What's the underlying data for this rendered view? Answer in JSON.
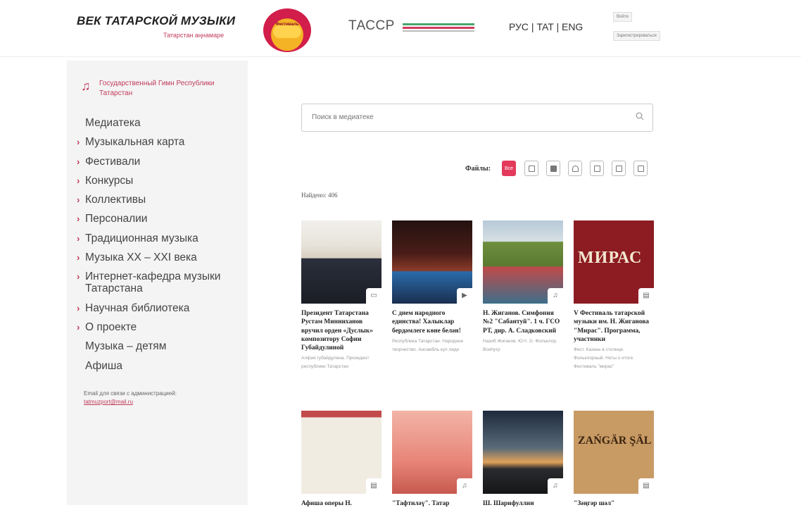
{
  "header": {
    "title": "ВЕК ТАТАРСКОЙ МУЗЫКИ",
    "subtitle": "Татарстан аңнамаре",
    "logo_text": "Фестиваль",
    "tassr": "ТАССР",
    "lang": "РУС | TAT | ENG",
    "login": "Войти",
    "register": "Зарегистрироваться"
  },
  "sidebar": {
    "anthem": "Государственный Гимн Республики Татарстан",
    "items": [
      {
        "label": "Медиатека",
        "arrow": false
      },
      {
        "label": "Музыкальная карта",
        "arrow": true
      },
      {
        "label": "Фестивали",
        "arrow": true
      },
      {
        "label": "Конкурсы",
        "arrow": true
      },
      {
        "label": "Коллективы",
        "arrow": true
      },
      {
        "label": "Персоналии",
        "arrow": true
      },
      {
        "label": "Традиционная музыка",
        "arrow": true
      },
      {
        "label": "Музыка XX – XXI века",
        "arrow": true
      },
      {
        "label": "Интернет-кафедра музыки Татарстана",
        "arrow": true
      },
      {
        "label": "Научная библиотека",
        "arrow": true
      },
      {
        "label": "О проекте",
        "arrow": true
      },
      {
        "label": "Музыка – детям",
        "arrow": false
      },
      {
        "label": "Афиша",
        "arrow": false
      }
    ],
    "arrow_glyph": "›",
    "contact_label": "Email для связи с администрацией:",
    "contact_email": "tatmuzport@mail.ru"
  },
  "search": {
    "placeholder": "Поиск в медиатеке"
  },
  "filters": {
    "label": "Файлы:",
    "all_label": "Все",
    "icons": [
      "article-icon",
      "image-icon",
      "video-icon",
      "audio-icon",
      "music-icon",
      "book-icon",
      "document-icon"
    ]
  },
  "found": "Найдено: 406",
  "cards": [
    {
      "title": "Президент Татарстана Рустам Минниханов вручил орден «Дуслык» композитору Софии Губайдулиной",
      "desc": "Алфия губайдулина. Президент республики Татарстан",
      "type_icon": "article-icon",
      "type_glyph": "▭"
    },
    {
      "title": "С днем народного единства! Халыклар бердәмлеге көне белән!",
      "desc": "Республика Татарстан. Народное творчество. Ансамбль кул лиде",
      "type_icon": "video-icon",
      "type_glyph": "▶"
    },
    {
      "title": "Н. Жиганов. Симфония №2 \"Сабантуй\". 1 ч. ГСО РТ, дир. А. Сладковский",
      "desc": "Назиб Жиганов. Ютт. 2г. Фольклор. Всеһутр",
      "type_icon": "audio-icon",
      "type_glyph": "♫"
    },
    {
      "title": "V Фестиваль татарской музыки им. Н. Жиганова \"Мирас\". Программа, участники",
      "desc": "Фест. Казань в столице. Фольклорный. Ноты о итоге. Фестиваль \"мирас\"",
      "type_icon": "document-icon",
      "type_glyph": "▤"
    },
    {
      "title": "Афиша оперы Н.",
      "desc": "",
      "type_icon": "document-icon",
      "type_glyph": "▤"
    },
    {
      "title": "\"Тафтиләү\". Татар",
      "desc": "",
      "type_icon": "audio-icon",
      "type_glyph": "♫"
    },
    {
      "title": "Ш. Шарифуллин",
      "desc": "",
      "type_icon": "audio-icon",
      "type_glyph": "♫"
    },
    {
      "title": "\"Зәңгәр шәл\"",
      "desc": "",
      "type_icon": "document-icon",
      "type_glyph": "▤"
    }
  ],
  "card3_image_text": "МИРАС",
  "card7_image_text": "ZAŃGÄR ŞÄL",
  "colors": {
    "accent": "#e33a5c",
    "brand": "#c03a5a",
    "sidebar_bg": "#f4f4f4"
  }
}
